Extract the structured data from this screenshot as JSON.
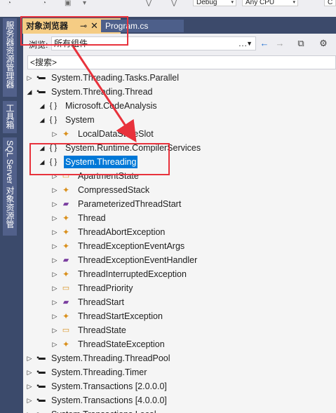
{
  "toolbar": {
    "config_combo": "Debug",
    "platform_combo": "Any CPU",
    "right_combo": "C"
  },
  "side_tabs": [
    "服务器资源管理器",
    "工具箱",
    "SQL Server 对象资源管理器"
  ],
  "tabs": {
    "active": {
      "label": "对象浏览器",
      "pin": "⊸",
      "close": "✕"
    },
    "inactive": {
      "label": "Program.cs"
    }
  },
  "browse": {
    "label": "浏览:",
    "value": "所有组件",
    "buttons": [
      "…",
      "←",
      "→",
      "⧉",
      "⚙"
    ]
  },
  "search": {
    "value": "<搜索>"
  },
  "tree": [
    {
      "exp": "▷",
      "icon": "asm",
      "label": "System.Threading.Tasks.Parallel"
    },
    {
      "exp": "◢",
      "icon": "asm",
      "label": "System.Threading.Thread"
    },
    {
      "exp": "◢",
      "icon": "ns",
      "label": "Microsoft.CodeAnalysis"
    },
    {
      "exp": "◢",
      "icon": "ns",
      "label": "System"
    },
    {
      "exp": "▷",
      "icon": "cls",
      "label": "LocalDataStoreSlot"
    },
    {
      "exp": "◢",
      "icon": "ns",
      "label": "System.Runtime.CompilerServices"
    },
    {
      "exp": "◢",
      "icon": "ns",
      "label": "System.Threading",
      "selected": true
    },
    {
      "exp": "▷",
      "icon": "enm",
      "label": "ApartmentState"
    },
    {
      "exp": "▷",
      "icon": "cls",
      "label": "CompressedStack"
    },
    {
      "exp": "▷",
      "icon": "dlg",
      "label": "ParameterizedThreadStart"
    },
    {
      "exp": "▷",
      "icon": "cls",
      "label": "Thread"
    },
    {
      "exp": "▷",
      "icon": "cls",
      "label": "ThreadAbortException"
    },
    {
      "exp": "▷",
      "icon": "cls",
      "label": "ThreadExceptionEventArgs"
    },
    {
      "exp": "▷",
      "icon": "dlg",
      "label": "ThreadExceptionEventHandler"
    },
    {
      "exp": "▷",
      "icon": "cls",
      "label": "ThreadInterruptedException"
    },
    {
      "exp": "▷",
      "icon": "enm",
      "label": "ThreadPriority"
    },
    {
      "exp": "▷",
      "icon": "dlg",
      "label": "ThreadStart"
    },
    {
      "exp": "▷",
      "icon": "cls",
      "label": "ThreadStartException"
    },
    {
      "exp": "▷",
      "icon": "enm",
      "label": "ThreadState"
    },
    {
      "exp": "▷",
      "icon": "cls",
      "label": "ThreadStateException"
    },
    {
      "exp": "▷",
      "icon": "asm",
      "label": "System.Threading.ThreadPool"
    },
    {
      "exp": "▷",
      "icon": "asm",
      "label": "System.Threading.Timer"
    },
    {
      "exp": "▷",
      "icon": "asm",
      "label": "System.Transactions [2.0.0.0]"
    },
    {
      "exp": "▷",
      "icon": "asm",
      "label": "System.Transactions [4.0.0.0]"
    },
    {
      "exp": "▷",
      "icon": "asm",
      "label": "System.Transactions.Local"
    }
  ],
  "icons": {
    "asm": "▪▬",
    "ns": "{ }",
    "cls": "✦",
    "dlg": "▰",
    "enm": "▭"
  },
  "colors": {
    "highlight_box": "#e8323c",
    "selection": "#0078d7",
    "active_tab": "#f5cc84"
  }
}
